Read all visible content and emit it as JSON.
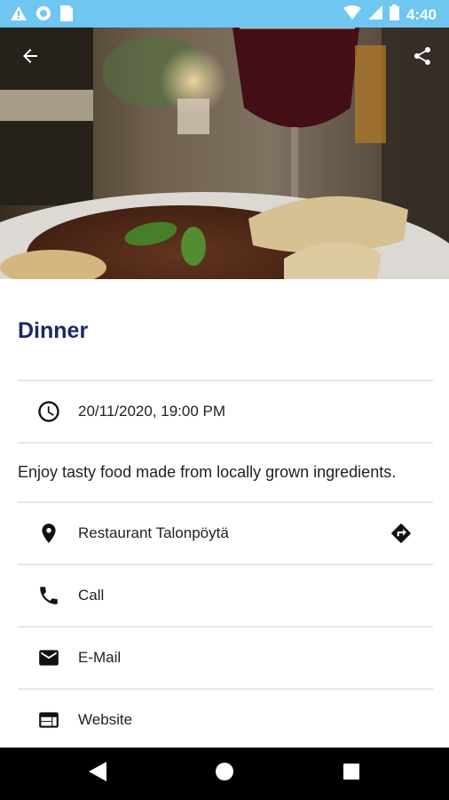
{
  "status_bar": {
    "time": "4:40",
    "left_icons": [
      "warning-icon",
      "circle-icon",
      "sim-card-icon"
    ],
    "right_icons": [
      "wifi-icon",
      "cell-signal-icon",
      "battery-icon"
    ]
  },
  "hero": {
    "back_icon": "arrow-left-icon",
    "share_icon": "share-icon"
  },
  "event": {
    "title": "Dinner",
    "datetime": "20/11/2020, 19:00 PM",
    "description": "Enjoy tasty food made from locally grown ingredients."
  },
  "contact": {
    "location": "Restaurant Talonpöytä",
    "call": "Call",
    "email": "E-Mail",
    "website": "Website"
  },
  "nav": [
    "back-triangle-icon",
    "home-circle-icon",
    "recents-square-icon"
  ],
  "colors": {
    "status_bar": "#6ec6f1",
    "title": "#1a2a63",
    "nav_bar": "#000000"
  }
}
